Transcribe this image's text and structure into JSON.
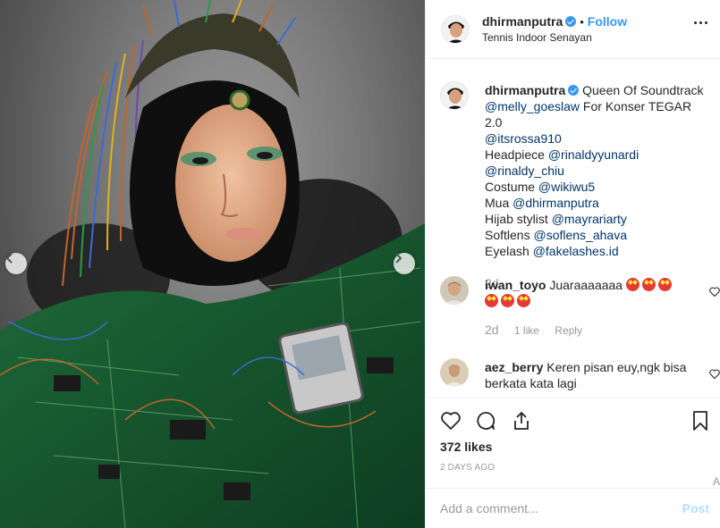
{
  "post": {
    "photo_alt": "",
    "prev_arrow": "chevron-left-icon",
    "next_arrow": "chevron-right-icon"
  },
  "header": {
    "username": "dhirmanputra",
    "separator": "•",
    "follow_label": "Follow",
    "location": "Tennis Indoor Senayan"
  },
  "caption": {
    "username": "dhirmanputra",
    "lines": [
      {
        "text": "Queen Of Soundtrack"
      },
      {
        "mention": "@melly_goeslaw",
        "text": " For Konser TEGAR 2.0"
      },
      {
        "mention": "@itsrossa910",
        "text": ""
      },
      {
        "prefix": "Headpiece ",
        "mention": "@rinaldyyunardi"
      },
      {
        "mention": "@rinaldy_chiu",
        "text": ""
      },
      {
        "prefix": "Costume ",
        "mention": "@wikiwu5"
      },
      {
        "prefix": "Mua ",
        "mention": "@dhirmanputra"
      },
      {
        "prefix": "Hijab stylist ",
        "mention": "@mayrariarty"
      },
      {
        "prefix": "Softlens ",
        "mention": "@soflens_ahava"
      },
      {
        "prefix": "Eyelash ",
        "mention": "@fakelashes.id"
      }
    ],
    "time": "2d"
  },
  "comments": [
    {
      "username": "iwan_toyo",
      "text": "Juaraaaaaaa",
      "time": "2d",
      "likes": "1 like",
      "reply": "Reply"
    },
    {
      "username": "aez_berry",
      "text": "Keren pisan euy,ngk bisa berkata kata lagi"
    }
  ],
  "actions": {
    "likes": "372 likes",
    "date": "2 DAYS AGO"
  },
  "composer": {
    "placeholder": "Add a comment...",
    "post_label": "Post"
  },
  "edge_char": "A",
  "colors": {
    "link": "#3897f0",
    "mention": "#003569",
    "post_disabled": "#b2dffc",
    "verified": "#3897f0"
  }
}
